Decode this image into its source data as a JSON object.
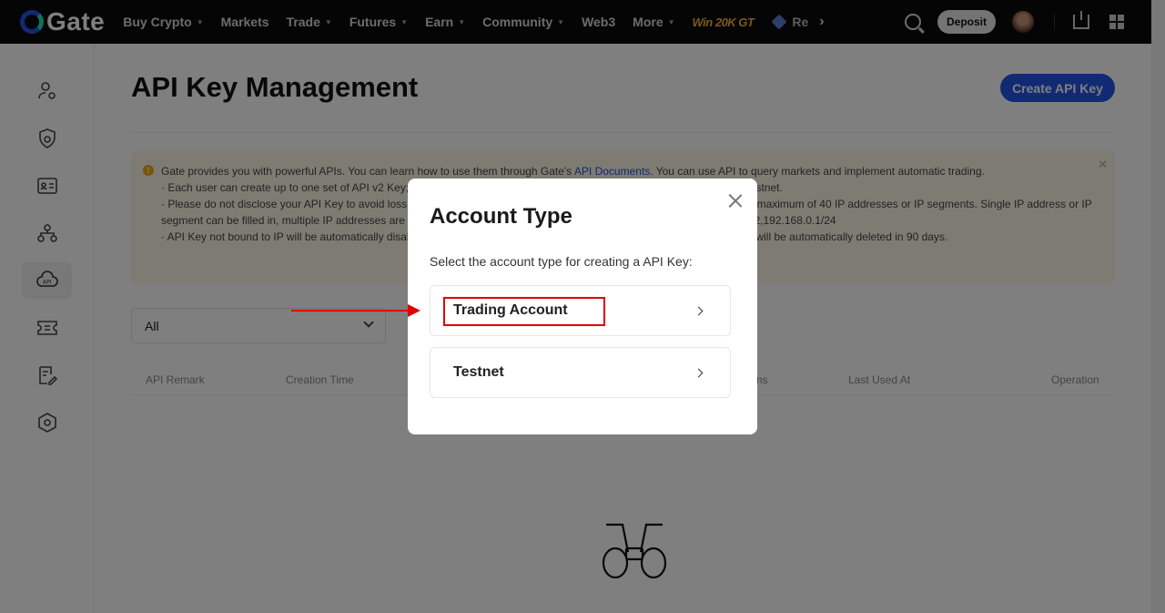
{
  "nav": {
    "brand": "Gate",
    "items": [
      {
        "label": "Buy Crypto",
        "caret": true
      },
      {
        "label": "Markets",
        "caret": false
      },
      {
        "label": "Trade",
        "caret": true
      },
      {
        "label": "Futures",
        "caret": true
      },
      {
        "label": "Earn",
        "caret": true
      },
      {
        "label": "Community",
        "caret": true
      },
      {
        "label": "Web3",
        "caret": false
      },
      {
        "label": "More",
        "caret": true
      }
    ],
    "promo": "Win 20K GT",
    "re_label": "Re",
    "deposit_label": "Deposit"
  },
  "sidebar": {
    "icons": [
      "user-settings-icon",
      "shield-icon",
      "id-card-icon",
      "sub-accounts-icon",
      "api-icon",
      "ticket-icon",
      "edit-document-icon",
      "settings-hexagon-icon"
    ],
    "active": "api-icon"
  },
  "page": {
    "title": "API Key Management",
    "create_button": "Create API Key"
  },
  "notice": {
    "line1_pre": "Gate provides you with powerful APIs. You can learn how to use them through Gate's ",
    "line1_link": "API Documents",
    "line1_post": ". You can use API to query markets and implement automatic trading.",
    "line2": "· Each user can create up to one set of API v2 Key; 20 sets of API 4 Key in Spot/Margin Account; 20 sets of API 4 Key in Testnet.",
    "line3": "· Please do not disclose your API Key to avoid loss of assets. Bind IP address for security. Each API key can be bound to a maximum of 40 IP addresses or IP segments. Single IP address or IP segment can be filled in, multiple IP addresses are separated by a half-width character comma. e.g.192.168.1.1,192.168.1.2,192.168.0.1/24",
    "line4": "· API Key not bound to IP will be automatically disabled. API Key which is not used (regardless of whether it is bound to IP) will be automatically deleted in 90 days."
  },
  "filter": {
    "selected": "All"
  },
  "table": {
    "headers": [
      "API Remark",
      "Creation Time",
      "ns",
      "Last Used At",
      "Operation"
    ]
  },
  "modal": {
    "title": "Account Type",
    "subtitle": "Select the account type for creating a API Key:",
    "options": [
      "Trading Account",
      "Testnet"
    ]
  },
  "colors": {
    "accent": "#2354e6",
    "highlight": "#e00000",
    "notice_bg": "#fdf7e6"
  }
}
